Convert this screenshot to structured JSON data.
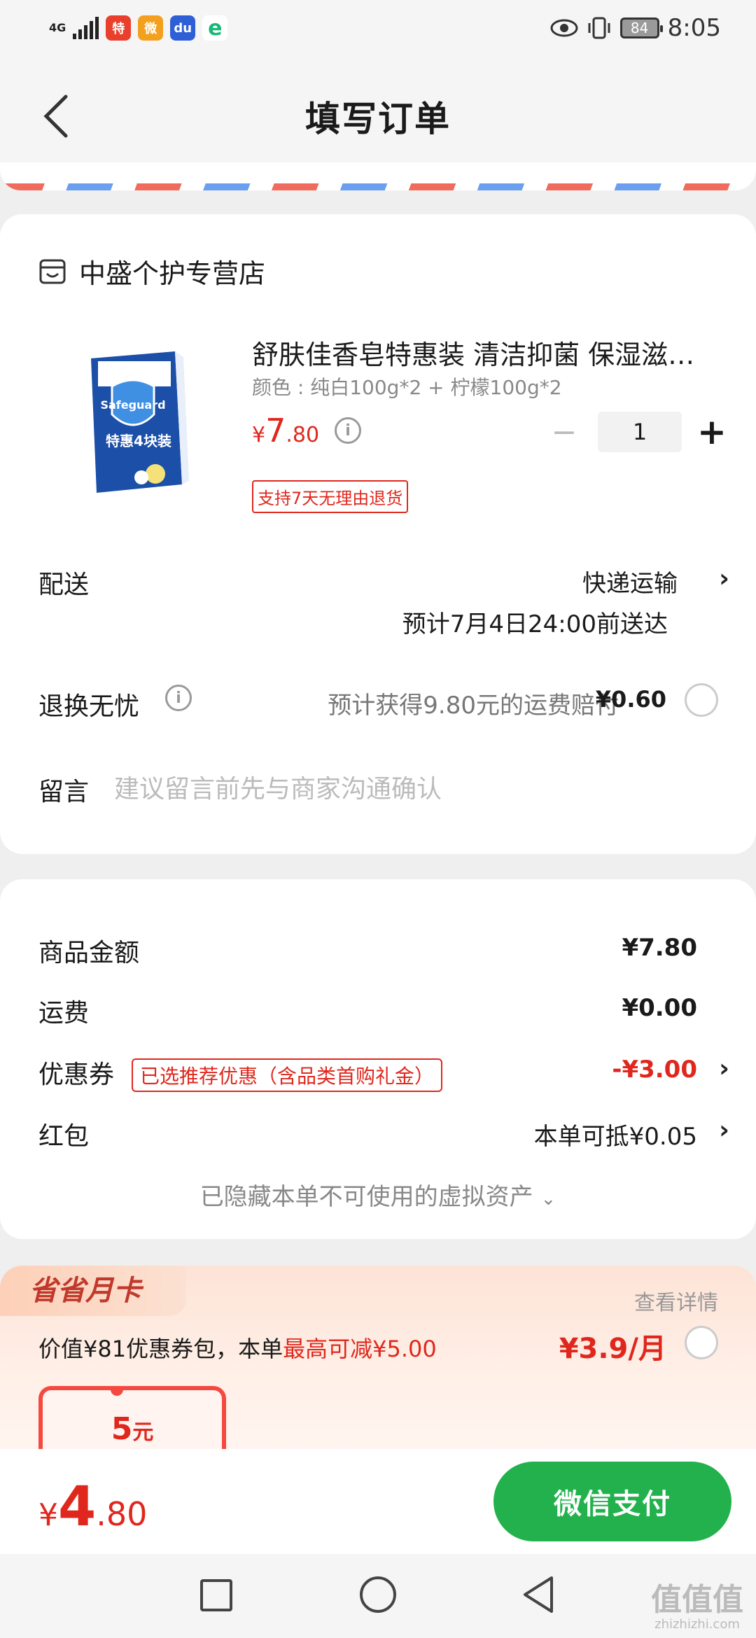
{
  "status_bar": {
    "network": "4G",
    "time": "8:05",
    "battery": "84",
    "app_icons": [
      {
        "name": "taobao-special-app-icon",
        "color": "#e8402c",
        "glyph": "特"
      },
      {
        "name": "weibo-app-icon",
        "color": "#f3a01f",
        "glyph": "微"
      },
      {
        "name": "baidu-app-icon",
        "color": "#2f5fd6",
        "glyph": "du"
      },
      {
        "name": "browser-app-icon",
        "color": "#17b978",
        "glyph": "e"
      }
    ]
  },
  "header": {
    "title": "填写订单"
  },
  "store": {
    "name": "中盛个护专营店"
  },
  "product": {
    "title": "舒肤佳香皂特惠装 清洁抑菌 保湿滋…",
    "spec": "颜色 : 纯白100g*2 + 柠檬100g*2",
    "price_currency": "¥",
    "price_int": "7",
    "price_dec": ".80",
    "quantity": "1",
    "badge": "支持7天无理由退货",
    "image_text_brand": "Safeguard",
    "image_text_deal": "特惠4块装"
  },
  "shipping": {
    "label": "配送",
    "method": "快递运输",
    "eta": "预计7月4日24:00前送达"
  },
  "returns": {
    "label": "退换无忧",
    "text": "预计获得9.80元的运费赔付",
    "fee": "¥0.60"
  },
  "note": {
    "label": "留言",
    "placeholder": "建议留言前先与商家沟通确认"
  },
  "summary": {
    "items_label": "商品金额",
    "items_value": "¥7.80",
    "freight_label": "运费",
    "freight_value": "¥0.00",
    "coupon_label": "优惠券",
    "coupon_tag": "已选推荐优惠（含品类首购礼金）",
    "coupon_value": "-¥3.00",
    "redpacket_label": "红包",
    "redpacket_value": "本单可抵¥0.05",
    "hidden_assets": "已隐藏本单不可使用的虚拟资产"
  },
  "promo": {
    "tag": "省省月卡",
    "detail_link": "查看详情",
    "desc_prefix": "价值¥81优惠券包，本单",
    "desc_highlight": "最高可减¥5.00",
    "price": "¥3.9/月",
    "voucher_value": "5",
    "voucher_unit": "元"
  },
  "footer": {
    "total_currency": "¥",
    "total_int": "4",
    "total_dec": ".80",
    "pay_button": "微信支付"
  },
  "watermark": {
    "logo": "值值值",
    "site": "zhizhizhi.com"
  },
  "colors": {
    "accent_red": "#e0271d",
    "pay_green": "#22b14c",
    "background": "#efefef"
  }
}
